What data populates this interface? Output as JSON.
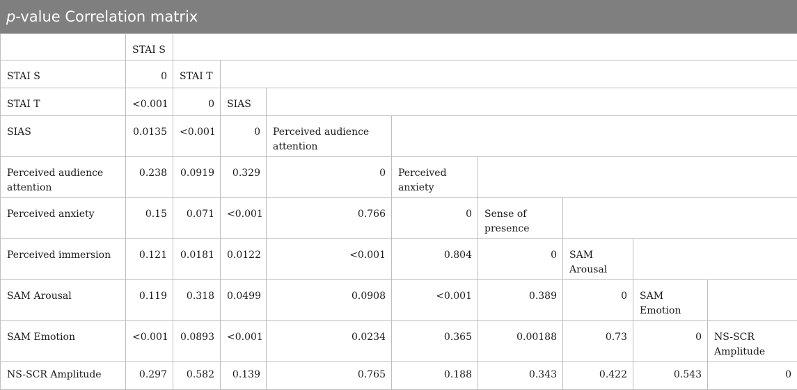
{
  "title": {
    "italic": "p",
    "rest": "-value Correlation matrix"
  },
  "header_row": [
    "",
    "STAI S"
  ],
  "rows": [
    {
      "label": "STAI S",
      "values": [
        "0"
      ],
      "diag_label": "STAI T"
    },
    {
      "label": "STAI T",
      "values": [
        "<0.001",
        "0"
      ],
      "diag_label": "SIAS"
    },
    {
      "label": "SIAS",
      "values": [
        "0.0135",
        "<0.001",
        "0"
      ],
      "diag_label": "Perceived audience attention"
    },
    {
      "label": "Perceived audience attention",
      "values": [
        "0.238",
        "0.0919",
        "0.329",
        "0"
      ],
      "diag_label": "Perceived anxiety"
    },
    {
      "label": "Perceived anxiety",
      "values": [
        "0.15",
        "0.071",
        "<0.001",
        "0.766",
        "0"
      ],
      "diag_label": "Sense of presence"
    },
    {
      "label": "Perceived immersion",
      "values": [
        "0.121",
        "0.0181",
        "0.0122",
        "<0.001",
        "0.804",
        "0"
      ],
      "diag_label": "SAM Arousal"
    },
    {
      "label": "SAM Arousal",
      "values": [
        "0.119",
        "0.318",
        "0.0499",
        "0.0908",
        "<0.001",
        "0.389",
        "0"
      ],
      "diag_label": "SAM Emotion"
    },
    {
      "label": "SAM Emotion",
      "values": [
        "<0.001",
        "0.0893",
        "<0.001",
        "0.0234",
        "0.365",
        "0.00188",
        "0.73",
        "0"
      ],
      "diag_label": "NS-SCR Amplitude"
    },
    {
      "label": "NS-SCR Amplitude",
      "values": [
        "0.297",
        "0.582",
        "0.139",
        "0.765",
        "0.188",
        "0.343",
        "0.422",
        "0.543",
        "0"
      ],
      "diag_label": ""
    }
  ]
}
